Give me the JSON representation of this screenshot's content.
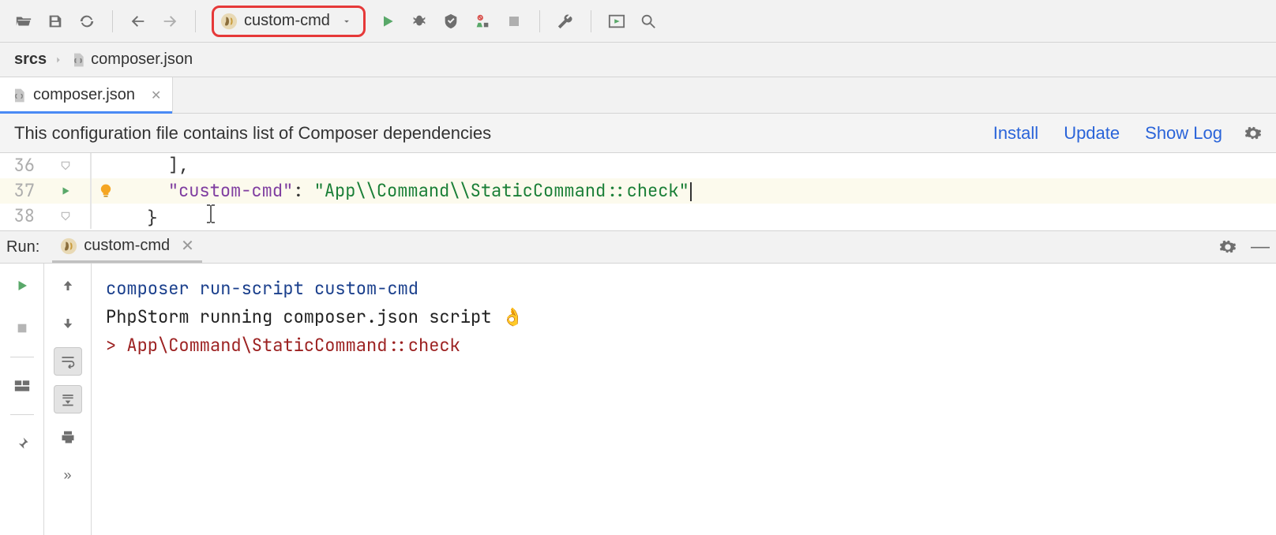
{
  "toolbar": {
    "run_config": "custom-cmd"
  },
  "breadcrumb": {
    "root": "srcs",
    "file": "composer.json"
  },
  "tab": {
    "label": "composer.json"
  },
  "infobar": {
    "message": "This configuration file contains list of Composer dependencies",
    "install": "Install",
    "update": "Update",
    "showlog": "Show Log"
  },
  "editor": {
    "lines": {
      "l36": {
        "num": "36",
        "text": "],"
      },
      "l37": {
        "num": "37",
        "key": "\"custom-cmd\"",
        "sep": ": ",
        "val": "\"App\\\\Command\\\\StaticCommand::check\""
      },
      "l38": {
        "num": "38",
        "text": "}"
      }
    }
  },
  "run": {
    "label": "Run:",
    "tab": "custom-cmd",
    "console": {
      "l1": "composer run-script custom-cmd",
      "l2_pre": "PhpStorm running composer.json script ",
      "l2_emoji": "👌",
      "l3": "> App\\Command\\StaticCommand::check"
    }
  }
}
